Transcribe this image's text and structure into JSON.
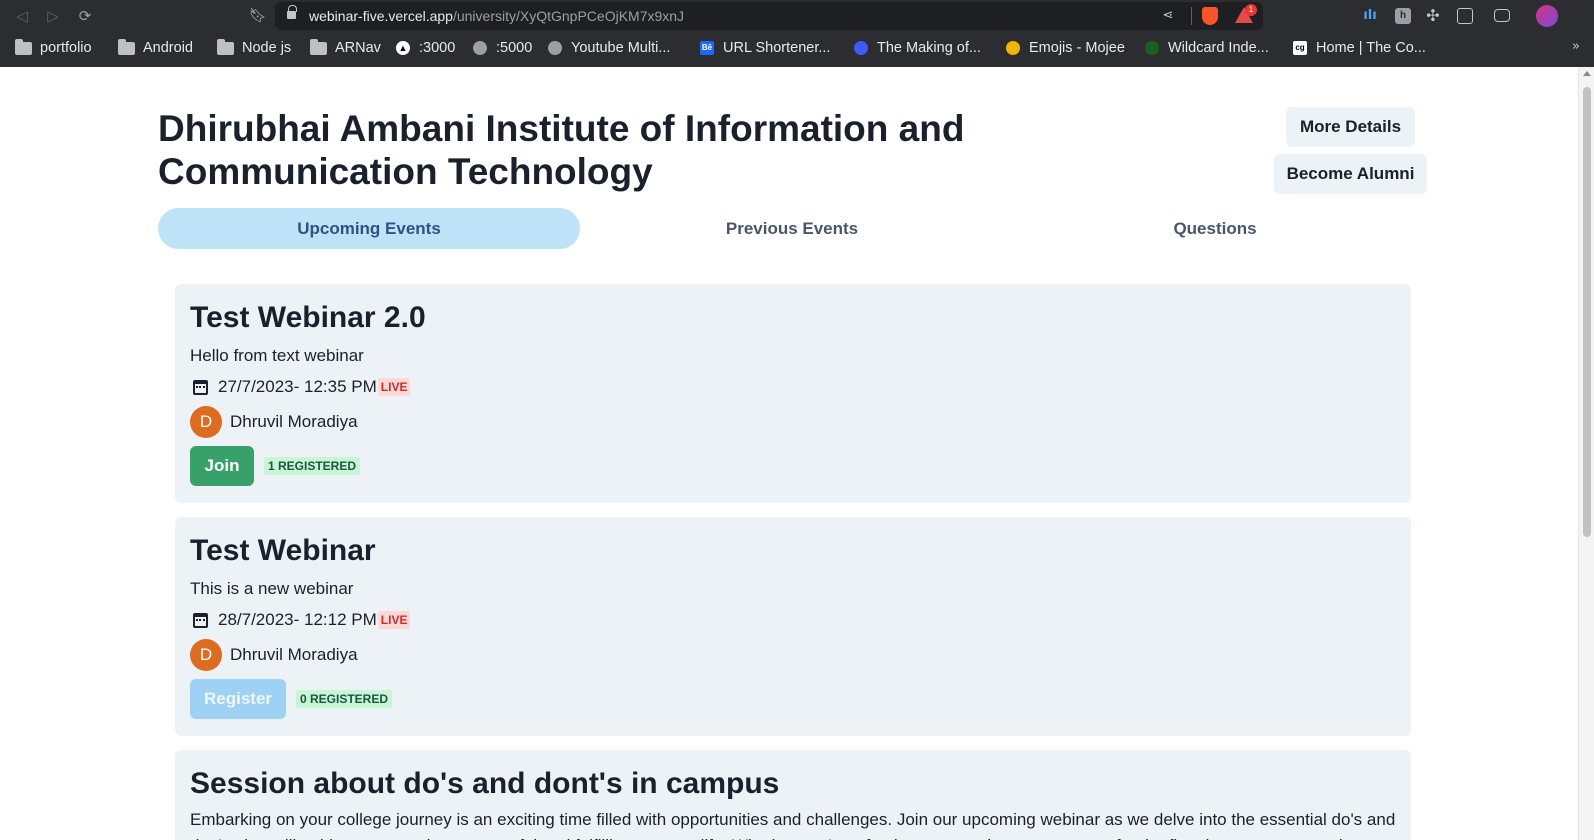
{
  "browser": {
    "url_domain": "webinar-five.vercel.app",
    "url_path": "/university/XyQtGnpPCeOjKM7x9xnJ",
    "alert_count": "1",
    "bookmarks": [
      {
        "label": "portfolio",
        "icon": "folder-icon"
      },
      {
        "label": "Android",
        "icon": "folder-icon"
      },
      {
        "label": "Node js",
        "icon": "folder-icon"
      },
      {
        "label": "ARNav",
        "icon": "folder-icon"
      },
      {
        "label": ":3000",
        "icon": "triangle-icon"
      },
      {
        "label": ":5000",
        "icon": "globe-icon"
      },
      {
        "label": "Youtube Multi...",
        "icon": "globe-icon"
      },
      {
        "label": "URL Shortener...",
        "icon": "behance-icon"
      },
      {
        "label": "The Making of...",
        "icon": "drop-icon"
      },
      {
        "label": "Emojis - Mojee",
        "icon": "emoji-icon"
      },
      {
        "label": "Wildcard Inde...",
        "icon": "leaf-icon"
      },
      {
        "label": "Home | The Co...",
        "icon": "cg-icon"
      }
    ]
  },
  "university": {
    "name": "Dhirubhai Ambani Institute of Information and Communication Technology",
    "more_details_label": "More Details",
    "become_alumni_label": "Become Alumni"
  },
  "tabs": [
    {
      "label": "Upcoming Events",
      "active": true
    },
    {
      "label": "Previous Events",
      "active": false
    },
    {
      "label": "Questions",
      "active": false
    }
  ],
  "events": [
    {
      "title": "Test Webinar 2.0",
      "description": "Hello from text webinar",
      "datetime": "27/7/2023- 12:35 PM",
      "status": "LIVE",
      "host_initial": "D",
      "host_name": "Dhruvil Moradiya",
      "action_label": "Join",
      "registered": "1 REGISTERED"
    },
    {
      "title": "Test Webinar",
      "description": "This is a new webinar",
      "datetime": "28/7/2023- 12:12 PM",
      "status": "LIVE",
      "host_initial": "D",
      "host_name": "Dhruvil Moradiya",
      "action_label": "Register",
      "registered": "0 REGISTERED"
    },
    {
      "title": "Session about do's and dont's in campus",
      "description": "Embarking on your college journey is an exciting time filled with opportunities and challenges. Join our upcoming webinar as we delve into the essential do's and don'ts that will guide you towards a successful and fulfilling campus life. Whether you're a fresher or returning, get answers for the first time as we try to give"
    }
  ],
  "colors": {
    "active_tab_bg": "#bee3f8",
    "join_button": "#38a169",
    "register_button": "#90cdf4",
    "live_badge_text": "#c53030",
    "avatar_bg": "#dd6b20"
  }
}
